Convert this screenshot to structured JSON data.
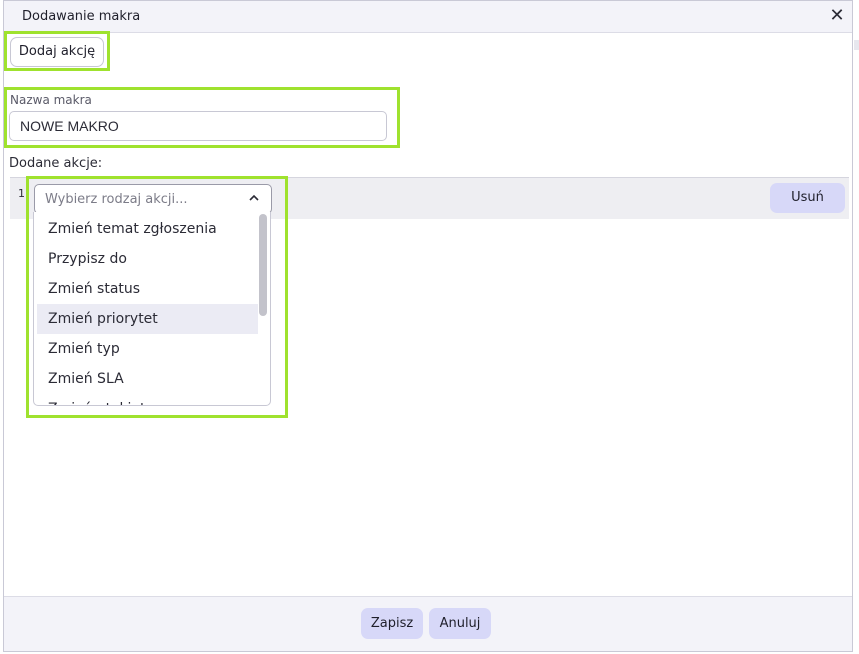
{
  "dialog": {
    "title": "Dodawanie makra",
    "close_symbol": "✕"
  },
  "toolbar": {
    "add_action_label": "Dodaj akcję"
  },
  "macro_name": {
    "label": "Nazwa makra",
    "value": "NOWE MAKRO"
  },
  "added_actions": {
    "label": "Dodane akcje:",
    "rows": [
      {
        "number": "1",
        "select_placeholder": "Wybierz rodzaj akcji...",
        "remove_label": "Usuń"
      }
    ]
  },
  "action_type_options": [
    "Zmień temat zgłoszenia",
    "Przypisz do",
    "Zmień status",
    "Zmień priorytet",
    "Zmień typ",
    "Zmień SLA",
    "Zmień etykiety"
  ],
  "footer": {
    "save_label": "Zapisz",
    "cancel_label": "Anuluj"
  },
  "colors": {
    "highlight": "#9fe22e",
    "primary_button": "#d7d8f8",
    "option_hover": "#ebebf4"
  },
  "icons": {
    "close": "close-icon",
    "chevron": "chevron-up-icon"
  }
}
